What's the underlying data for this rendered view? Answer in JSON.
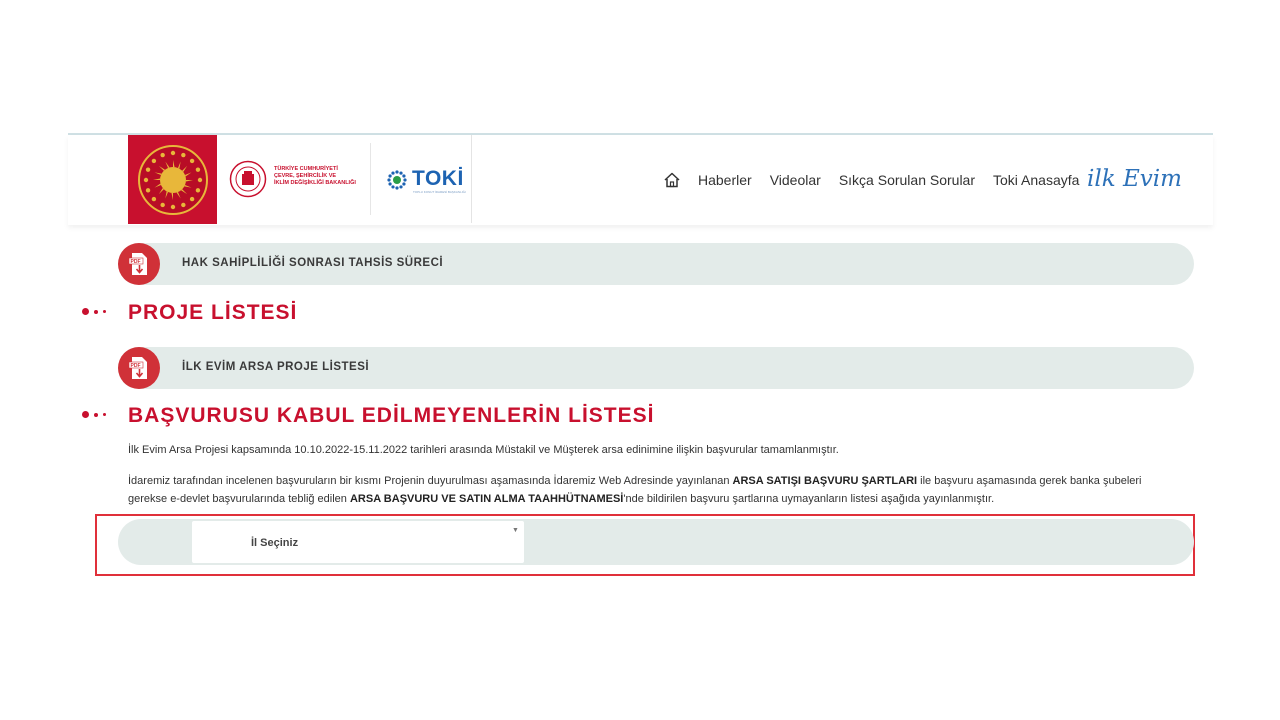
{
  "header": {
    "ministry_logo_text": "TÜRKİYE CUMHURİYETİ\nÇEVRE, ŞEHİRCİLİK VE\nİKLİM DEĞİŞİKLİĞİ BAKANLIĞI",
    "toki_logo_text": "TOKİ",
    "toki_logo_subtext": "TOPLU KONUT İDARESİ BAŞKANLIĞI",
    "nav": [
      {
        "label": "Haberler"
      },
      {
        "label": "Videolar"
      },
      {
        "label": "Sıkça Sorulan Sorular"
      },
      {
        "label": "Toki Anasayfa"
      }
    ],
    "brand": "ilk Evim"
  },
  "sections": {
    "hak_sahipligi_link": "HAK SAHİPLİLİĞİ SONRASI TAHSİS SÜRECİ",
    "proje_listesi_title": "PROJE LİSTESİ",
    "arsa_proje_link": "İLK EVİM ARSA PROJE LİSTESİ",
    "basvuru_title": "BAŞVURUSU KABUL EDİLMEYENLERİN LİSTESİ"
  },
  "paragraphs": {
    "p1": "İlk Evim Arsa Projesi kapsamında 10.10.2022-15.11.2022 tarihleri arasında Müstakil ve Müşterek arsa edinimine ilişkin başvurular tamamlanmıştır.",
    "p2_a": "İdaremiz tarafından incelenen başvuruların bir kısmı Projenin duyurulması aşamasında İdaremiz Web Adresinde yayınlanan ",
    "p2_b": "ARSA SATIŞI BAŞVURU ŞARTLARI",
    "p2_c": " ile başvuru aşamasında gerek banka şubeleri gerekse e-devlet başvurularında tebliğ edilen ",
    "p2_d": "ARSA BAŞVURU VE SATIN ALMA TAAHHÜTNAMESİ",
    "p2_e": "'nde bildirilen başvuru şartlarına uymayanların listesi aşağıda yayınlanmıştır."
  },
  "select": {
    "selected": "İl Seçiniz"
  },
  "colors": {
    "accent_red": "#c8102e",
    "pill_bg": "#e3ebe9",
    "brand_blue": "#2d71b8",
    "highlight_border": "#e0303a"
  },
  "icons": [
    "seal-icon",
    "ministry-logo-icon",
    "toki-logo-icon",
    "home-icon",
    "pdf-download-icon",
    "chevron-down-icon"
  ]
}
